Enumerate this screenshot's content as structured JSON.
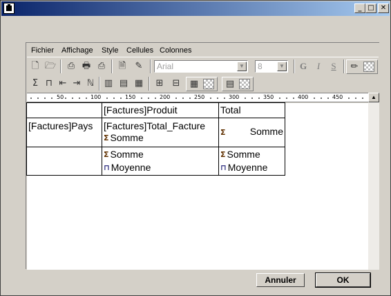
{
  "window": {
    "title": "",
    "controls": {
      "minimize": "_",
      "maximize": "□",
      "close": "✕"
    }
  },
  "menu": [
    "Fichier",
    "Affichage",
    "Style",
    "Cellules",
    "Colonnes"
  ],
  "toolbar1": {
    "font_combo": "Arial",
    "size_combo": "8",
    "bold": "G",
    "italic": "I",
    "underline": "S",
    "icons": [
      "new-document-icon",
      "open-folder-icon",
      "print-preview-icon",
      "print-icon",
      "print-setup-icon",
      "page-setup-icon",
      "edit-icon",
      "pencil-icon",
      "pattern-icon"
    ]
  },
  "toolbar2": {
    "icons": [
      "sum-icon",
      "average-icon",
      "insert-column-left-icon",
      "insert-column-right-icon",
      "count-icon",
      "grid-lines-icon",
      "table-icon",
      "lines-icon",
      "cell-borders-icon",
      "cell-fill-icon",
      "column-border-icon",
      "column-fill-icon"
    ]
  },
  "ruler": {
    "labels": [
      "50",
      "100",
      "150",
      "200",
      "250",
      "300",
      "350",
      "400",
      "450"
    ]
  },
  "report": {
    "header_row": {
      "produit": "[Factures]Produit",
      "total": "Total"
    },
    "data_row": {
      "pays": "[Factures]Pays",
      "total_facture": "[Factures]Total_Facture",
      "somme1": "Somme",
      "somme2": "Somme"
    },
    "totals_row": {
      "somme_a": "Somme",
      "moyenne_a": "Moyenne",
      "somme_b": "Somme",
      "moyenne_b": "Moyenne"
    }
  },
  "buttons": {
    "cancel": "Annuler",
    "ok": "OK"
  }
}
